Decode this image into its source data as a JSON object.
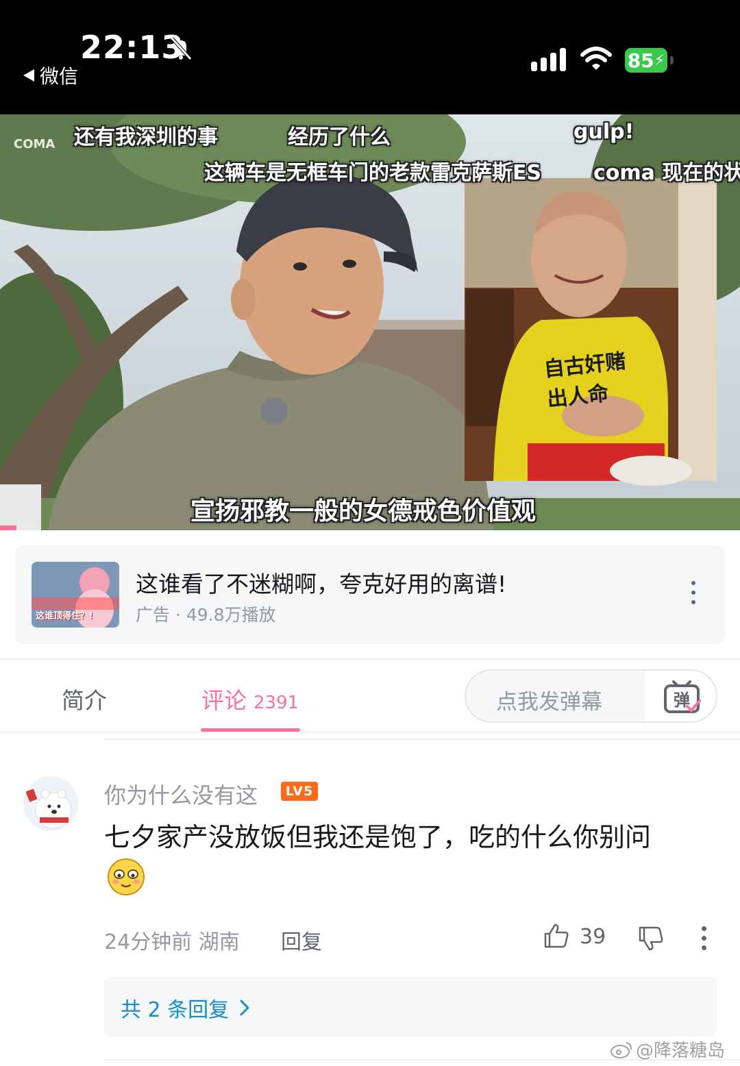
{
  "status_bar": {
    "time": "22:13",
    "back_label": "微信",
    "battery": "85"
  },
  "video": {
    "watermark": "COMA",
    "subtitles": {
      "line1a": "还有我深圳的事",
      "line1b": "经历了什么",
      "line1c": "gulp!",
      "line2a": "这辆车是无框车门的老款雷克萨斯ES",
      "line2b": "coma 现在的状",
      "bottom": "宣扬邪教一般的女德戒色价值观"
    },
    "shirt_text": "自古奸赌出人命"
  },
  "ad": {
    "title": "这谁看了不迷糊啊，夸克好用的离谱!",
    "meta": "广告 · 49.8万播放",
    "thumb_caption": "这谁顶得住？!"
  },
  "tabs": {
    "intro": "简介",
    "comments": "评论",
    "comments_count": "2391"
  },
  "danmaku": {
    "placeholder": "点我发弹幕",
    "button_glyph": "弹"
  },
  "comment": {
    "username": "你为什么没有这",
    "level": "LV5",
    "text": "七夕家产没放饭但我还是饱了，吃的什么你别问",
    "time_location": "24分钟前  湖南",
    "reply_label": "回复",
    "like_count": "39",
    "replies_label": "共 2 条回复"
  },
  "watermark": {
    "text": "@降落糖岛"
  },
  "colors": {
    "accent": "#fb7299",
    "link": "#178bcf",
    "level_badge": "#ff6a1a",
    "battery": "#3ac84d"
  }
}
